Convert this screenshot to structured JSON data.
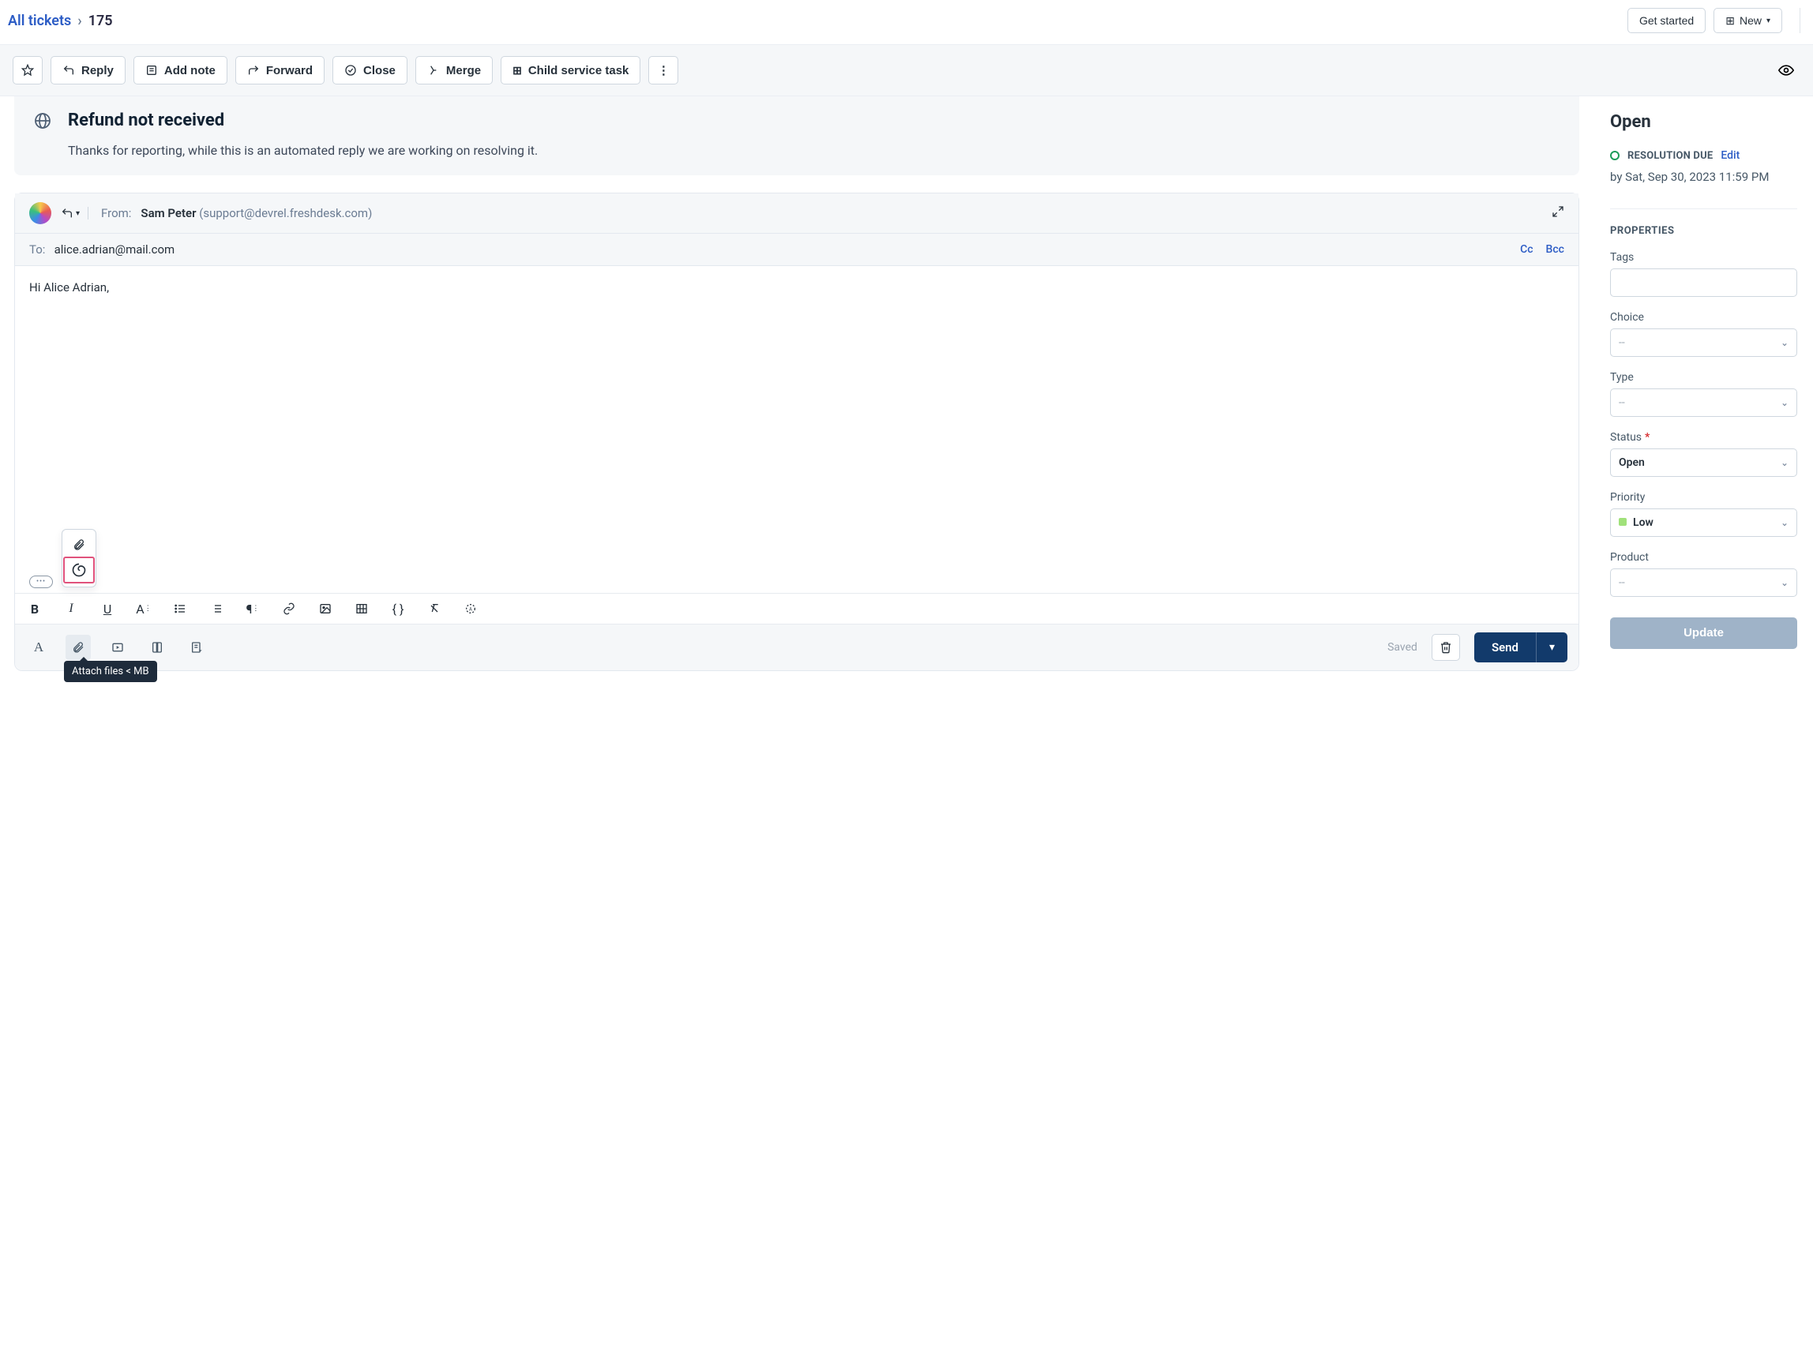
{
  "breadcrumb": {
    "parent": "All tickets",
    "ticket_id": "175"
  },
  "topbar": {
    "get_started": "Get started",
    "new_label": "New"
  },
  "actions": {
    "reply": "Reply",
    "add_note": "Add note",
    "forward": "Forward",
    "close": "Close",
    "merge": "Merge",
    "child": "Child service task"
  },
  "ticket": {
    "title": "Refund not received",
    "preview": "Thanks for reporting, while this is an automated reply we are working on resolving it."
  },
  "composer": {
    "from_label": "From:",
    "from_name": "Sam Peter",
    "from_email": "(support@devrel.freshdesk.com)",
    "to_label": "To:",
    "to_addr": "alice.adrian@mail.com",
    "cc_label": "Cc",
    "bcc_label": "Bcc",
    "body_line1": "Hi Alice Adrian,",
    "saved": "Saved",
    "send": "Send",
    "attach_tooltip": "Attach files < MB"
  },
  "side": {
    "status_heading": "Open",
    "resolution_label": "RESOLUTION DUE",
    "edit": "Edit",
    "resolution_time": "by Sat, Sep 30, 2023 11:59 PM",
    "properties_heading": "PROPERTIES",
    "tags_label": "Tags",
    "choice_label": "Choice",
    "choice_value": "--",
    "type_label": "Type",
    "type_value": "--",
    "status_label": "Status",
    "status_value": "Open",
    "priority_label": "Priority",
    "priority_value": "Low",
    "product_label": "Product",
    "product_value": "--",
    "update": "Update"
  }
}
